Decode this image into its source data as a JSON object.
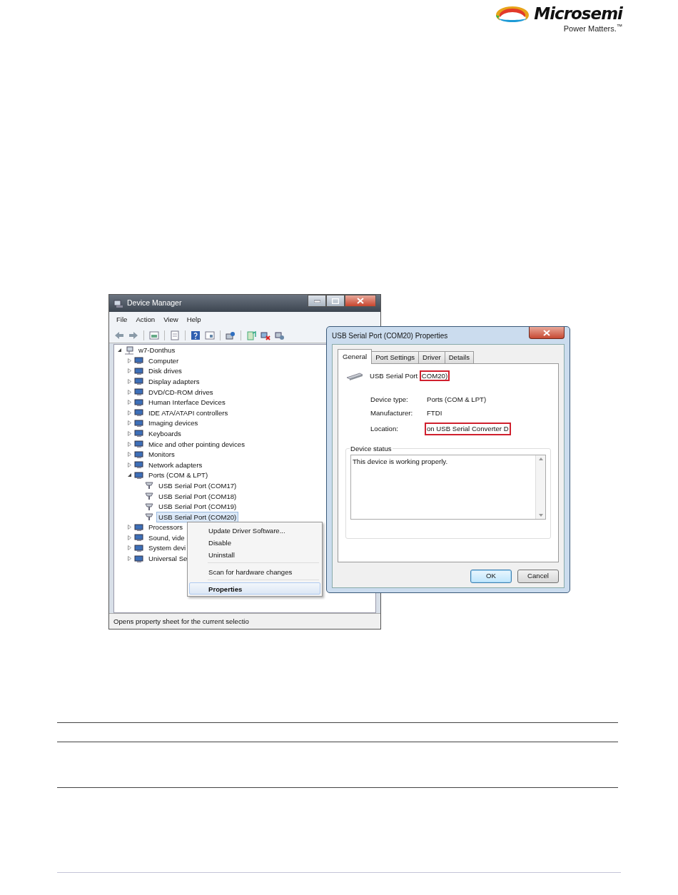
{
  "header": {
    "logo": {
      "name": "Microsemi",
      "tagline": "Power Matters.$^{™}$"
    }
  },
  "device_manager": {
    "title": "Device Manager",
    "menu": [
      "File",
      "Action",
      "View",
      "Help"
    ],
    "tree": [
      {
        "label": "w7-Donthus",
        "expanded": true,
        "selected": false,
        "children": [
          {
            "label": "Computer",
            "expanded": false,
            "selected": false
          },
          {
            "label": "Disk drives",
            "expanded": false,
            "selected": false
          },
          {
            "label": "Display adapters",
            "expanded": false,
            "selected": false
          },
          {
            "label": "DVD/CD-ROM drives",
            "expanded": false,
            "selected": false
          },
          {
            "label": "Human Interface Devices",
            "expanded": false,
            "selected": false
          },
          {
            "label": "IDE ATA/ATAPI controllers",
            "expanded": false,
            "selected": false
          },
          {
            "label": "Imaging devices",
            "expanded": false,
            "selected": false
          },
          {
            "label": "Keyboards",
            "expanded": false,
            "selected": false
          },
          {
            "label": "Mice and other pointing devices",
            "expanded": false,
            "selected": false
          },
          {
            "label": "Monitors",
            "expanded": false,
            "selected": false
          },
          {
            "label": "Network adapters",
            "expanded": false,
            "selected": false
          },
          {
            "label": "Ports (COM & LPT)",
            "expanded": true,
            "selected": false,
            "children": [
              {
                "label": "USB Serial Port (COM17)",
                "selected": false
              },
              {
                "label": "USB Serial Port (COM18)",
                "selected": false
              },
              {
                "label": "USB Serial Port (COM19)",
                "selected": false
              },
              {
                "label": "USB Serial Port (COM20)",
                "selected": true
              }
            ]
          },
          {
            "label": "Processors",
            "expanded": false,
            "selected": false
          },
          {
            "label": "Sound, vide",
            "expanded": false,
            "selected": false
          },
          {
            "label": "System devi",
            "expanded": false,
            "selected": false
          },
          {
            "label": "Universal Se",
            "expanded": false,
            "selected": false
          }
        ]
      }
    ],
    "status_bar": "Opens property sheet for the current selectio"
  },
  "context_menu": [
    {
      "label": "Update Driver Software...",
      "separator_before": false,
      "bold": false,
      "highlighted": false
    },
    {
      "label": "Disable",
      "separator_before": false,
      "bold": false,
      "highlighted": false
    },
    {
      "label": "Uninstall",
      "separator_before": false,
      "bold": false,
      "highlighted": false
    },
    {
      "label": "Scan for hardware changes",
      "separator_before": true,
      "bold": false,
      "highlighted": false
    },
    {
      "label": "Properties",
      "separator_before": true,
      "bold": true,
      "highlighted": true
    }
  ],
  "properties_dialog": {
    "title": "USB Serial Port (COM20) Properties",
    "tabs": [
      {
        "label": "General",
        "selected": true
      },
      {
        "label": "Port Settings",
        "selected": false
      },
      {
        "label": "Driver",
        "selected": false
      },
      {
        "label": "Details",
        "selected": false
      }
    ],
    "device_name": {
      "text": "USB Serial Port",
      "boxed": "COM20)"
    },
    "properties": [
      {
        "label": "Device type:",
        "value": "Ports (COM & LPT)",
        "highlighted": false
      },
      {
        "label": "Manufacturer:",
        "value": "FTDI",
        "highlighted": false
      },
      {
        "label": "Location:",
        "value": "on USB Serial Converter D",
        "highlighted": true
      }
    ],
    "device_status": {
      "label": "Device status",
      "value": "This device is working properly."
    },
    "buttons": [
      {
        "label": "OK",
        "default": true
      },
      {
        "label": "Cancel",
        "default": false
      }
    ]
  }
}
